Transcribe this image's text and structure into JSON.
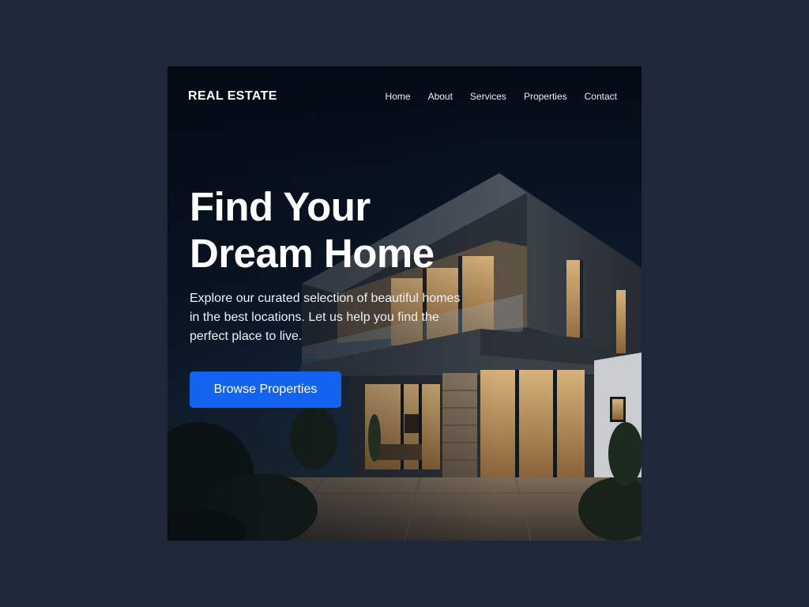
{
  "colors": {
    "page_background": "#1f2838",
    "accent": "#1363f0",
    "text": "#ffffff"
  },
  "nav": {
    "logo": "REAL ESTATE",
    "links": [
      "Home",
      "About",
      "Services",
      "Properties",
      "Contact"
    ]
  },
  "hero": {
    "title_line1": "Find Your",
    "title_line2": "Dream Home",
    "subtitle_line1": "Explore our curated selection of beautiful homes",
    "subtitle_line2": "in the best locations. Let us help you find the",
    "subtitle_line3": "perfect place to live.",
    "cta_label": "Browse Properties",
    "image": "modern-house-at-night"
  }
}
